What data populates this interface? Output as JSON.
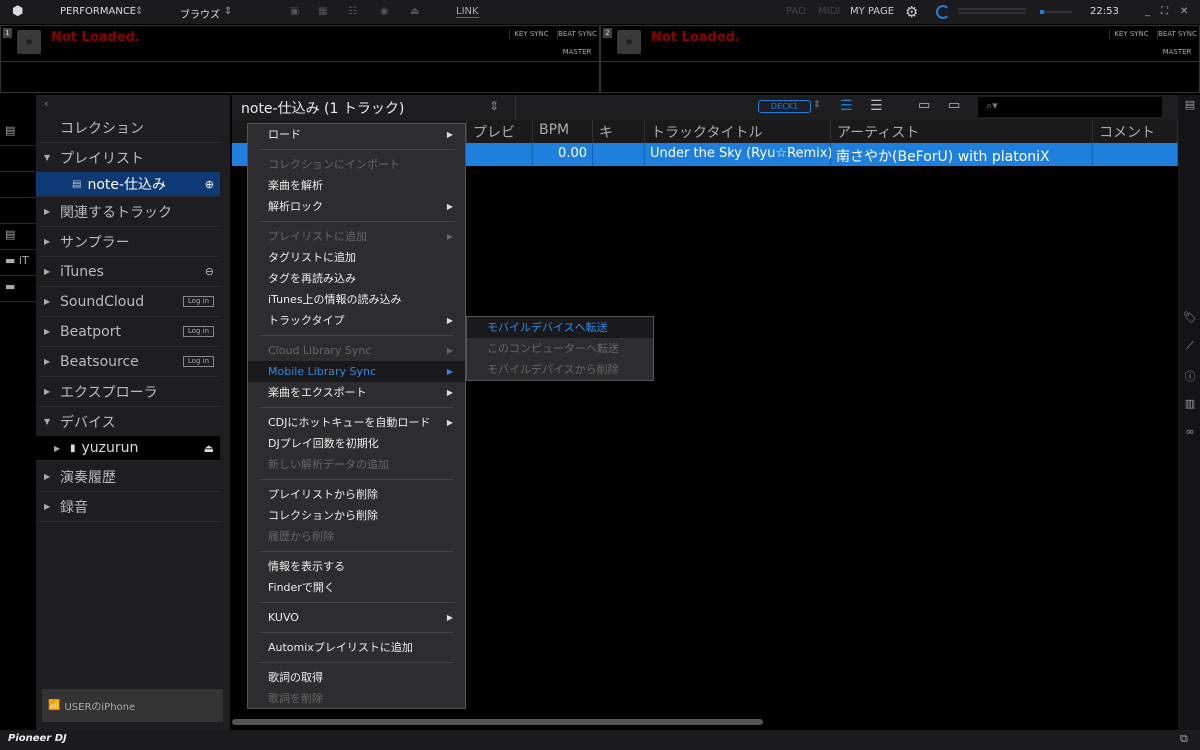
{
  "topbar": {
    "mode": "PERFORMANCE",
    "view": "ブラウズ",
    "link": "LINK",
    "pad": "PAD",
    "midi": "MIDI",
    "mypage": "MY PAGE",
    "clock": "22:53"
  },
  "decks": [
    {
      "number": "1",
      "status": "Not Loaded.",
      "key_sync": "KEY SYNC",
      "beat_sync": "BEAT SYNC",
      "master": "MASTER"
    },
    {
      "number": "2",
      "status": "Not Loaded.",
      "key_sync": "KEY SYNC",
      "beat_sync": "BEAT SYNC",
      "master": "MASTER"
    }
  ],
  "leftstrip": {
    "itunes_label": "iT"
  },
  "sidebar": {
    "items": [
      {
        "label": "コレクション",
        "expander": ""
      },
      {
        "label": "プレイリスト",
        "expander": "▼"
      },
      {
        "label": "note-仕込み",
        "expander": ""
      },
      {
        "label": "関連するトラック",
        "expander": "▶"
      },
      {
        "label": "サンプラー",
        "expander": "▶"
      },
      {
        "label": "iTunes",
        "expander": "▶"
      },
      {
        "label": "SoundCloud",
        "expander": "▶",
        "login": "Log in"
      },
      {
        "label": "Beatport",
        "expander": "▶",
        "login": "Log in"
      },
      {
        "label": "Beatsource",
        "expander": "▶",
        "login": "Log in"
      },
      {
        "label": "エクスプローラ",
        "expander": "▶"
      },
      {
        "label": "デバイス",
        "expander": "▼"
      },
      {
        "label": "yuzurun",
        "expander": "▶"
      },
      {
        "label": "演奏履歴",
        "expander": "▶"
      },
      {
        "label": "録音",
        "expander": "▶"
      }
    ],
    "device_button": "USERのiPhone"
  },
  "browser": {
    "title": "note-仕込み (1 トラック)",
    "deck_target": "DECK1",
    "columns": [
      "プレビュー",
      "BPM",
      "キ",
      "トラックタイトル",
      "アーティスト",
      "コメント"
    ],
    "rows": [
      {
        "bpm": "0.00",
        "key": "",
        "title": "Under the Sky (Ryu☆Remix)",
        "artist": "南さやか(BeForU) with platoniX",
        "comment": ""
      }
    ]
  },
  "context_menu": [
    {
      "label": "ロード",
      "submenu": true
    },
    {
      "sep": true
    },
    {
      "label": "コレクションにインポート",
      "disabled": true
    },
    {
      "label": "楽曲を解析"
    },
    {
      "label": "解析ロック",
      "submenu": true
    },
    {
      "sep": true
    },
    {
      "label": "プレイリストに追加",
      "disabled": true,
      "submenu": true
    },
    {
      "label": "タグリストに追加"
    },
    {
      "label": "タグを再読み込み"
    },
    {
      "label": "iTunes上の情報の読み込み"
    },
    {
      "label": "トラックタイプ",
      "submenu": true
    },
    {
      "sep": true
    },
    {
      "label": "Cloud Library Sync",
      "disabled": true,
      "submenu": true
    },
    {
      "label": "Mobile Library Sync",
      "highlighted": true,
      "submenu": true
    },
    {
      "label": "楽曲をエクスポート",
      "submenu": true
    },
    {
      "sep": true
    },
    {
      "label": "CDJにホットキューを自動ロード",
      "submenu": true
    },
    {
      "label": "DJプレイ回数を初期化"
    },
    {
      "label": "新しい解析データの追加",
      "disabled": true
    },
    {
      "sep": true
    },
    {
      "label": "プレイリストから削除"
    },
    {
      "label": "コレクションから削除"
    },
    {
      "label": "履歴から削除",
      "disabled": true
    },
    {
      "sep": true
    },
    {
      "label": "情報を表示する"
    },
    {
      "label": "Finderで開く"
    },
    {
      "sep": true
    },
    {
      "label": "KUVO",
      "submenu": true
    },
    {
      "sep": true
    },
    {
      "label": "Automixプレイリストに追加"
    },
    {
      "sep": true
    },
    {
      "label": "歌詞の取得"
    },
    {
      "label": "歌詞を削除",
      "disabled": true
    }
  ],
  "submenu": [
    {
      "label": "モバイルデバイスへ転送",
      "highlighted": true
    },
    {
      "label": "このコンピューターへ転送",
      "disabled": true
    },
    {
      "label": "モバイルデバイスから削除",
      "disabled": true
    }
  ],
  "footer": {
    "logo": "Pioneer DJ"
  },
  "colors": {
    "accent": "#1e7fdc",
    "selected_sidebar": "#0d3a75",
    "not_loaded": "#8b0000"
  }
}
